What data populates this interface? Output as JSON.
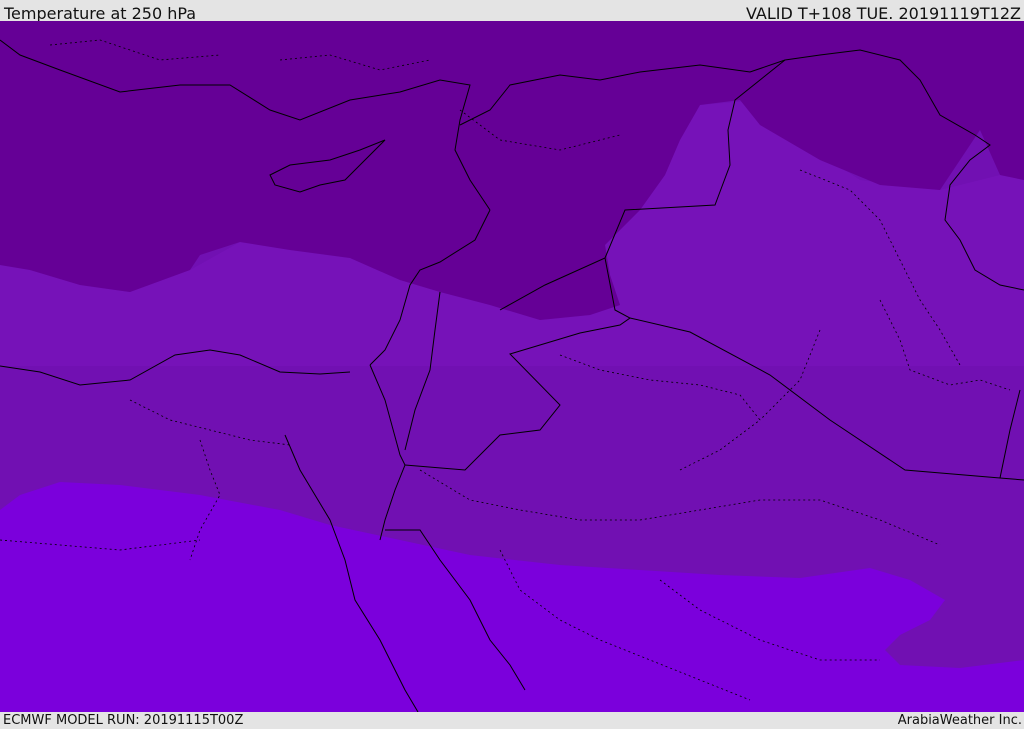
{
  "header": {
    "title": "Temperature at 250 hPa",
    "valid": "VALID T+108 TUE. 20191119T12Z"
  },
  "footer": {
    "model_run": "ECMWF MODEL RUN: 20191115T00Z",
    "credit": "ArabiaWeather Inc."
  },
  "map": {
    "field": "temperature-250hPa",
    "colors": {
      "coldest_band": "#650096",
      "middle_band": "#7110b2",
      "upper_middle_band": "#7612b8",
      "warmest_band": "#7b00dc",
      "border_line": "#000000"
    }
  }
}
